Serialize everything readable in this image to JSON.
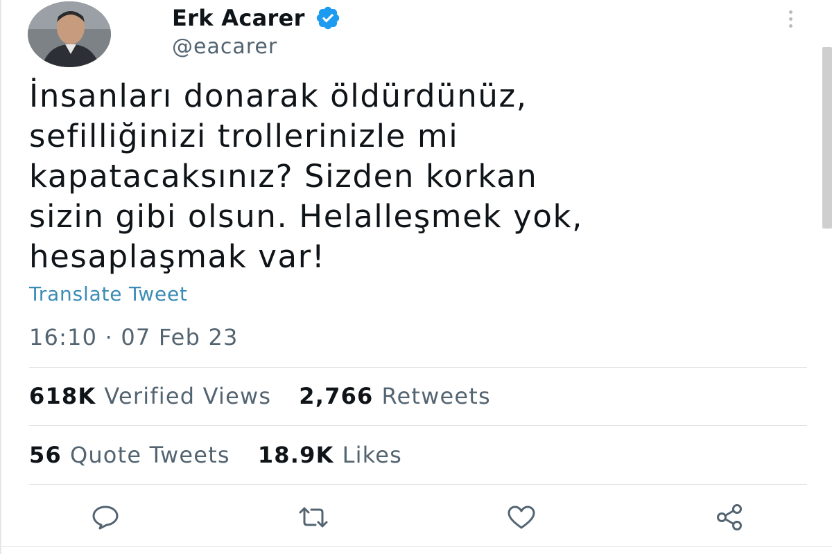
{
  "user": {
    "display_name": "Erk Acarer",
    "handle": "@eacarer"
  },
  "tweet": {
    "lines": [
      "İnsanları donarak öldürdünüz,",
      "sefilliğinizi trollerinizle mi",
      "kapatacaksınız? Sizden korkan",
      "sizin gibi olsun. Helalleşmek yok,",
      "hesaplaşmak var!"
    ],
    "translate_label": "Translate Tweet",
    "timestamp": "16:10 · 07 Feb 23"
  },
  "stats": {
    "views_count": "618K",
    "views_label": "Verified Views",
    "retweets_count": "2,766",
    "retweets_label": "Retweets",
    "quotes_count": "56",
    "quotes_label": "Quote Tweets",
    "likes_count": "18.9K",
    "likes_label": "Likes"
  },
  "actions": {
    "reply_icon": "reply-icon",
    "retweet_icon": "retweet-icon",
    "like_icon": "heart-icon",
    "share_icon": "share-icon"
  },
  "colors": {
    "text": "#0f1419",
    "secondary": "#536471",
    "link": "#3a8bb5",
    "verified": "#1d9bf0",
    "icon": "#536471"
  }
}
